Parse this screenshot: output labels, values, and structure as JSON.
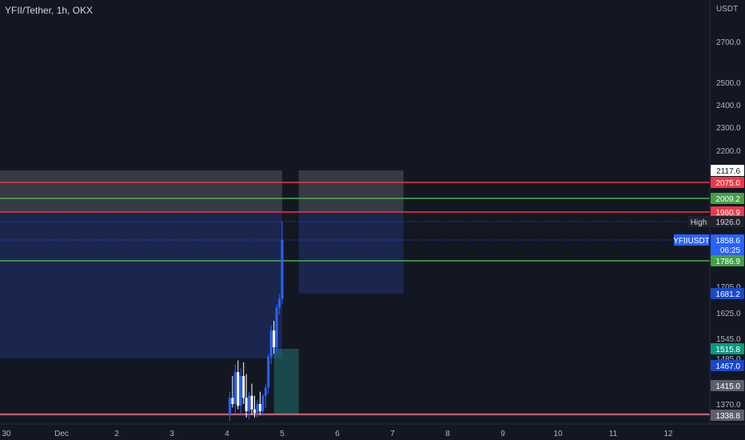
{
  "header": {
    "symbol_title": "YFII/Tether, 1h, OKX"
  },
  "axis": {
    "currency": "USDT"
  },
  "colors": {
    "background": "#131722",
    "red_line": "#f23645",
    "green_line": "#4caf50",
    "cyan_line": "#26c6da",
    "blue_zone": "#1e2e6b",
    "grey_zone": "#4a4d56",
    "candle_up": "#2962ff",
    "candle_down": "#ffffff"
  },
  "chart_data": {
    "type": "candlestick",
    "title": "YFII/Tether, 1h, OKX",
    "ylim": [
      1330,
      2800
    ],
    "y_ticks": [
      "2700.0",
      "2500.0",
      "2400.0",
      "2300.0",
      "2200.0",
      "1705.0",
      "1625.0",
      "1545.0",
      "1485.0",
      "1370.0"
    ],
    "x_ticks": [
      "30",
      "Dec",
      "2",
      "3",
      "4",
      "5",
      "6",
      "7",
      "8",
      "9",
      "10",
      "11",
      "12"
    ],
    "price_lines": [
      {
        "price": 2075.0,
        "color": "red",
        "label": "2075.0"
      },
      {
        "price": 2009.2,
        "color": "green",
        "label": "2009.2"
      },
      {
        "price": 1960.9,
        "color": "red",
        "label": "1960.9"
      },
      {
        "price": 1786.9,
        "color": "green",
        "label": "1786.9"
      },
      {
        "price": 1342.0,
        "color": "cyan",
        "label": ""
      },
      {
        "price": 1340.0,
        "color": "red",
        "label": ""
      }
    ],
    "dotted_lines": [
      {
        "price": 1926.0,
        "label": "1926.0",
        "tag": "High"
      },
      {
        "price": 1858.6,
        "label": "1858.6",
        "tag": "YFIIUSDT",
        "countdown": "06:25"
      }
    ],
    "price_labels": [
      {
        "price": 2117.6,
        "label": "2117.6",
        "style": "white"
      },
      {
        "price": 1681.2,
        "label": "1681.2",
        "style": "blue"
      },
      {
        "price": 1515.8,
        "label": "1515.8",
        "style": "teal"
      },
      {
        "price": 1467.0,
        "label": "1467.0",
        "style": "blue"
      },
      {
        "price": 1415.0,
        "label": "1415.0",
        "style": "grey"
      },
      {
        "price": 1338.8,
        "label": "1338.8",
        "style": "grey"
      }
    ],
    "candles_day": [
      {
        "x": 4.05,
        "o": 1340,
        "h": 1400,
        "l": 1330,
        "c": 1385
      },
      {
        "x": 4.1,
        "o": 1385,
        "h": 1440,
        "l": 1360,
        "c": 1370
      },
      {
        "x": 4.15,
        "o": 1370,
        "h": 1470,
        "l": 1345,
        "c": 1450
      },
      {
        "x": 4.2,
        "o": 1450,
        "h": 1480,
        "l": 1355,
        "c": 1365
      },
      {
        "x": 4.25,
        "o": 1365,
        "h": 1460,
        "l": 1340,
        "c": 1440
      },
      {
        "x": 4.3,
        "o": 1440,
        "h": 1475,
        "l": 1370,
        "c": 1385
      },
      {
        "x": 4.35,
        "o": 1385,
        "h": 1445,
        "l": 1335,
        "c": 1350
      },
      {
        "x": 4.4,
        "o": 1350,
        "h": 1400,
        "l": 1332,
        "c": 1390
      },
      {
        "x": 4.45,
        "o": 1390,
        "h": 1420,
        "l": 1340,
        "c": 1355
      },
      {
        "x": 4.5,
        "o": 1355,
        "h": 1390,
        "l": 1335,
        "c": 1345
      },
      {
        "x": 4.55,
        "o": 1345,
        "h": 1380,
        "l": 1335,
        "c": 1370
      },
      {
        "x": 4.6,
        "o": 1370,
        "h": 1400,
        "l": 1340,
        "c": 1350
      },
      {
        "x": 4.65,
        "o": 1350,
        "h": 1395,
        "l": 1338,
        "c": 1390
      },
      {
        "x": 4.7,
        "o": 1390,
        "h": 1420,
        "l": 1360,
        "c": 1410
      },
      {
        "x": 4.75,
        "o": 1410,
        "h": 1500,
        "l": 1395,
        "c": 1490
      },
      {
        "x": 4.8,
        "o": 1490,
        "h": 1585,
        "l": 1470,
        "c": 1570
      },
      {
        "x": 4.85,
        "o": 1570,
        "h": 1600,
        "l": 1500,
        "c": 1520
      },
      {
        "x": 4.9,
        "o": 1520,
        "h": 1650,
        "l": 1505,
        "c": 1640
      },
      {
        "x": 4.95,
        "o": 1640,
        "h": 1680,
        "l": 1620,
        "c": 1665
      },
      {
        "x": 5.0,
        "o": 1665,
        "h": 1926,
        "l": 1650,
        "c": 1858.6
      }
    ],
    "zones": [
      {
        "x0": 29.0,
        "x1": 5.0,
        "y0": 2117.6,
        "y1": 1960.9,
        "kind": "grey"
      },
      {
        "x0": 29.0,
        "x1": 5.0,
        "y0": 1960.9,
        "y1": 1485.0,
        "kind": "blue"
      },
      {
        "x0": 5.3,
        "x1": 7.2,
        "y0": 2117.6,
        "y1": 1960.9,
        "kind": "grey"
      },
      {
        "x0": 5.3,
        "x1": 7.2,
        "y0": 1960.9,
        "y1": 1681.2,
        "kind": "blue"
      },
      {
        "x0": 4.85,
        "x1": 5.3,
        "y0": 1515.8,
        "y1": 1342.0,
        "kind": "teal"
      }
    ]
  }
}
